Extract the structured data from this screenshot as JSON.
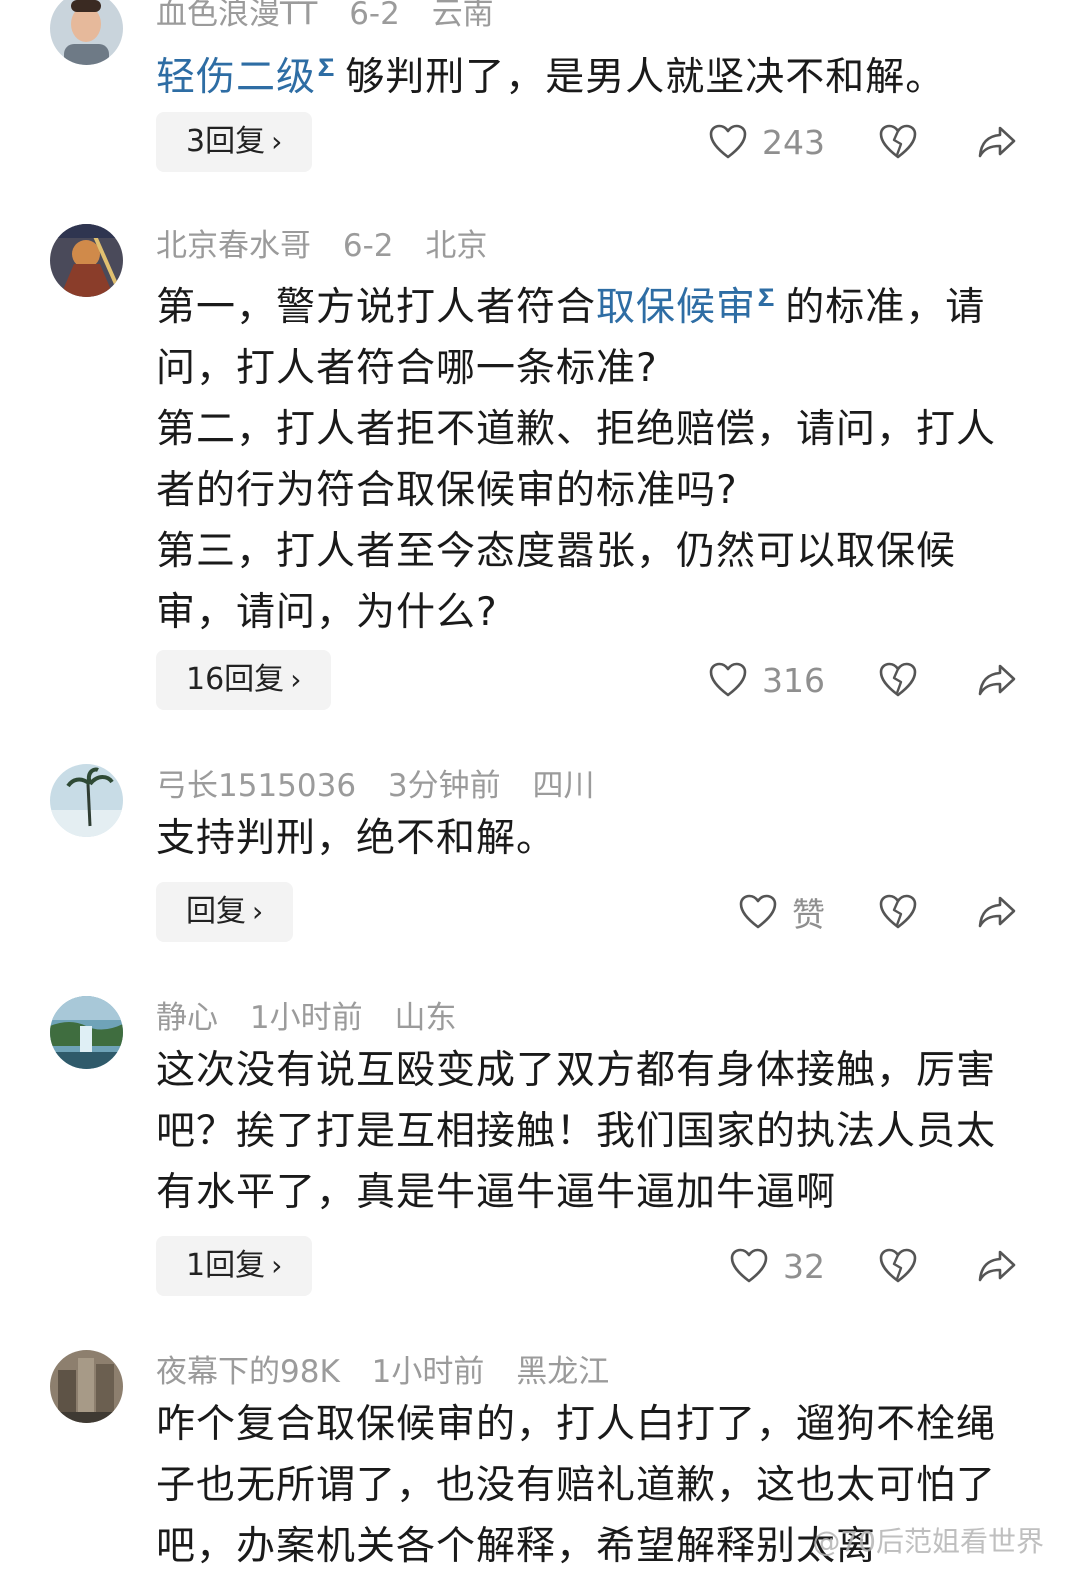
{
  "comments": [
    {
      "username": "血色浪漫TT",
      "date": "6-2",
      "location": "云南",
      "text_link": "轻伤二级",
      "text_rest": "够判刑了，是男人就坚决不和解。",
      "reply_label": "3回复",
      "like_count": "243"
    },
    {
      "username": "北京春水哥",
      "date": "6-2",
      "location": "北京",
      "text_before_link": "第一，警方说打人者符合",
      "text_link": "取保候审",
      "text_after_link": "的标准，请问，打人者符合哪一条标准?",
      "para2": "第二，打人者拒不道歉、拒绝赔偿，请问，打人者的行为符合取保候审的标准吗?",
      "para3": "第三，打人者至今态度嚣张，仍然可以取保候审，请问，为什么?",
      "reply_label": "16回复",
      "like_count": "316"
    },
    {
      "username": "弓长1515036",
      "date": "3分钟前",
      "location": "四川",
      "text": "支持判刑，绝不和解。",
      "reply_label": "回复",
      "like_count": "赞"
    },
    {
      "username": "静心",
      "date": "1小时前",
      "location": "山东",
      "text": "这次没有说互殴变成了双方都有身体接触，厉害吧？挨了打是互相接触！我们国家的执法人员太有水平了，真是牛逼牛逼牛逼加牛逼啊",
      "reply_label": "1回复",
      "like_count": "32"
    },
    {
      "username": "夜幕下的98K",
      "date": "1小时前",
      "location": "黑龙江",
      "text": "咋个复合取保候审的，打人白打了，遛狗不栓绳子也无所谓了，也没有赔礼道歉，这也太可怕了吧，办案机关各个解释，希望解释别太离"
    }
  ],
  "icons": {
    "like": "heart-outline-icon",
    "dislike": "broken-heart-icon",
    "share": "share-arrow-icon",
    "link_marker": "search-icon"
  },
  "colors": {
    "link": "#2e6da4",
    "meta": "#9b9b9b",
    "text": "#1a1a1a",
    "reply_bg": "#f3f3f3"
  },
  "watermark": "@70后范姐看世界"
}
